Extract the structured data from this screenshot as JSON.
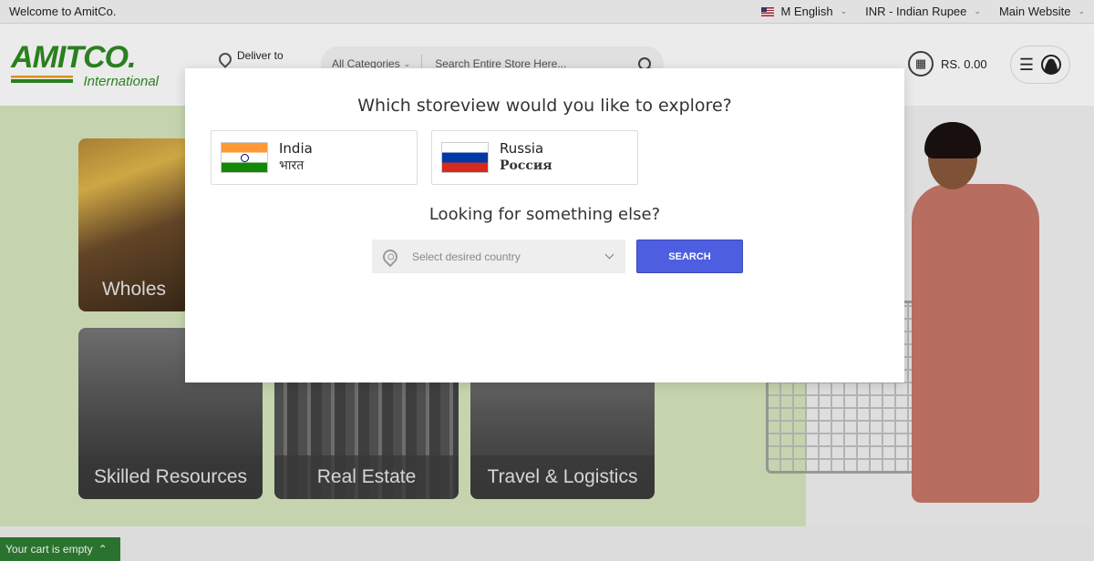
{
  "topbar": {
    "welcome": "Welcome to AmitCo.",
    "language": "M English",
    "currency": "INR - Indian Rupee",
    "website": "Main Website"
  },
  "header": {
    "logo_main": "AMITCO.",
    "logo_sub": "International",
    "deliver_label": "Deliver to",
    "search_category": "All Categories",
    "search_placeholder": "Search Entire Store Here...",
    "cart_total": "RS. 0.00"
  },
  "tiles": {
    "wholesale": "Wholes",
    "skilled": "Skilled Resources",
    "real_estate": "Real Estate",
    "travel": "Travel & Logistics"
  },
  "cart_bar": {
    "label": "Your cart is empty"
  },
  "modal": {
    "title": "Which storeview would you like to explore?",
    "stores": [
      {
        "name": "India",
        "native": "भारत"
      },
      {
        "name": "Russia",
        "native": "Россия"
      }
    ],
    "subtitle": "Looking for something else?",
    "country_placeholder": "Select desired country",
    "search_label": "SEARCH",
    "accent_color": "#4d5fe0"
  }
}
